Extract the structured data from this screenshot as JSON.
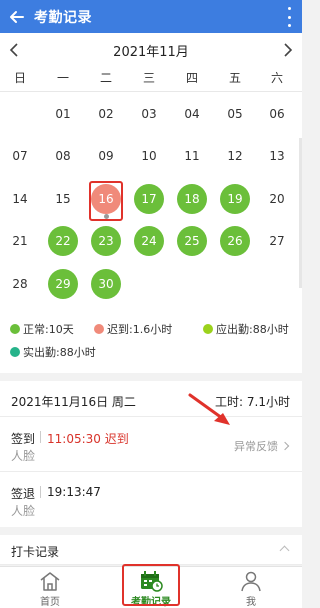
{
  "appbar": {
    "title": "考勤记录"
  },
  "calendar": {
    "month_label": "2021年11月",
    "weekdays": [
      "日",
      "一",
      "二",
      "三",
      "四",
      "五",
      "六"
    ],
    "selected_day": "16",
    "days": [
      {
        "d": "01",
        "col": 1,
        "row": 0,
        "status": "none"
      },
      {
        "d": "02",
        "col": 2,
        "row": 0,
        "status": "none"
      },
      {
        "d": "03",
        "col": 3,
        "row": 0,
        "status": "none"
      },
      {
        "d": "04",
        "col": 4,
        "row": 0,
        "status": "none"
      },
      {
        "d": "05",
        "col": 5,
        "row": 0,
        "status": "none"
      },
      {
        "d": "06",
        "col": 6,
        "row": 0,
        "status": "none"
      },
      {
        "d": "07",
        "col": 0,
        "row": 1,
        "status": "none"
      },
      {
        "d": "08",
        "col": 1,
        "row": 1,
        "status": "none"
      },
      {
        "d": "09",
        "col": 2,
        "row": 1,
        "status": "none"
      },
      {
        "d": "10",
        "col": 3,
        "row": 1,
        "status": "none"
      },
      {
        "d": "11",
        "col": 4,
        "row": 1,
        "status": "none"
      },
      {
        "d": "12",
        "col": 5,
        "row": 1,
        "status": "none"
      },
      {
        "d": "13",
        "col": 6,
        "row": 1,
        "status": "none"
      },
      {
        "d": "14",
        "col": 0,
        "row": 2,
        "status": "none"
      },
      {
        "d": "15",
        "col": 1,
        "row": 2,
        "status": "none"
      },
      {
        "d": "16",
        "col": 2,
        "row": 2,
        "status": "late"
      },
      {
        "d": "17",
        "col": 3,
        "row": 2,
        "status": "normal"
      },
      {
        "d": "18",
        "col": 4,
        "row": 2,
        "status": "normal"
      },
      {
        "d": "19",
        "col": 5,
        "row": 2,
        "status": "normal"
      },
      {
        "d": "20",
        "col": 6,
        "row": 2,
        "status": "none"
      },
      {
        "d": "21",
        "col": 0,
        "row": 3,
        "status": "none"
      },
      {
        "d": "22",
        "col": 1,
        "row": 3,
        "status": "normal"
      },
      {
        "d": "23",
        "col": 2,
        "row": 3,
        "status": "normal"
      },
      {
        "d": "24",
        "col": 3,
        "row": 3,
        "status": "normal"
      },
      {
        "d": "25",
        "col": 4,
        "row": 3,
        "status": "normal"
      },
      {
        "d": "26",
        "col": 5,
        "row": 3,
        "status": "normal"
      },
      {
        "d": "27",
        "col": 6,
        "row": 3,
        "status": "none"
      },
      {
        "d": "28",
        "col": 0,
        "row": 4,
        "status": "none"
      },
      {
        "d": "29",
        "col": 1,
        "row": 4,
        "status": "normal"
      },
      {
        "d": "30",
        "col": 2,
        "row": 4,
        "status": "normal"
      }
    ]
  },
  "legend": [
    {
      "label": "正常:10天",
      "color": "#6bbf3a"
    },
    {
      "label": "迟到:1.6小时",
      "color": "#f08a7a"
    },
    {
      "label": "应出勤:88小时",
      "color": "#9bd21c"
    },
    {
      "label": "实出勤:88小时",
      "color": "#26b38a"
    }
  ],
  "detail": {
    "date": "2021年11月16日 周二",
    "work_hours": "工时: 7.1小时",
    "check_in": {
      "label": "签到",
      "time": "11:05:30 迟到",
      "method": "人脸",
      "feedback": "异常反馈"
    },
    "check_out": {
      "label": "签退",
      "time": "19:13:47",
      "method": "人脸"
    }
  },
  "punch_records": {
    "label": "打卡记录"
  },
  "tabbar": [
    {
      "label": "首页",
      "icon": "home-icon",
      "active": false
    },
    {
      "label": "考勤记录",
      "icon": "attendance-calendar-icon",
      "active": true
    },
    {
      "label": "我",
      "icon": "user-icon",
      "active": false
    }
  ],
  "colors": {
    "primary": "#3d7de0",
    "normal": "#6bbf3a",
    "late": "#f08a7a",
    "late_text": "#d8332a",
    "highlight": "#e0322b",
    "active_tab": "#2d8a22"
  }
}
